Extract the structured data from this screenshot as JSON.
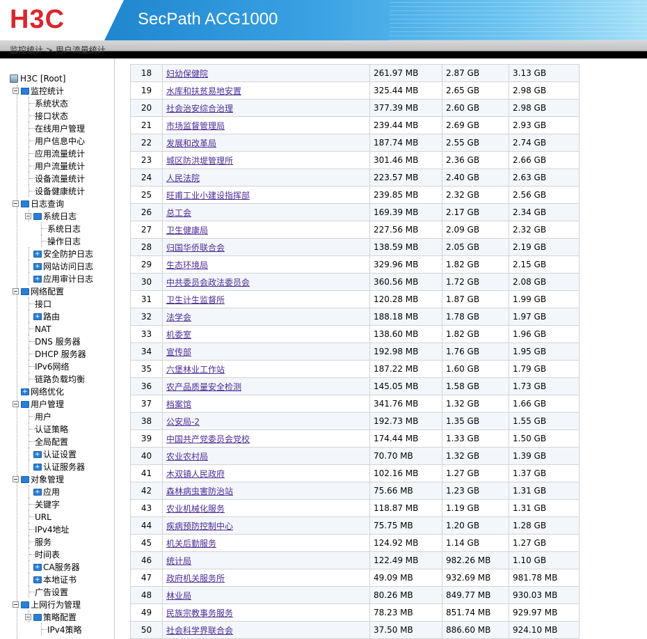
{
  "header": {
    "logo": "H3C",
    "product": "SecPath ACG1000"
  },
  "breadcrumb": {
    "part1": "监控统计",
    "sep": " > ",
    "part2": "用户流量统计"
  },
  "tree": {
    "root": "H3C [Root]",
    "items": [
      "监控统计",
      "系统状态",
      "接口状态",
      "在线用户管理",
      "用户信息中心",
      "应用流量统计",
      "用户流量统计",
      "设备流量统计",
      "设备健康统计",
      "日志查询",
      "系统日志",
      "系统日志",
      "操作日志",
      "安全防护日志",
      "网站访问日志",
      "应用审计日志",
      "网络配置",
      "接口",
      "路由",
      "NAT",
      "DNS 服务器",
      "DHCP 服务器",
      "IPv6网络",
      "链路负载均衡",
      "网络优化",
      "用户管理",
      "用户",
      "认证策略",
      "全局配置",
      "认证设置",
      "认证服务器",
      "对象管理",
      "应用",
      "关键字",
      "URL",
      "IPv4地址",
      "服务",
      "时间表",
      "CA服务器",
      "本地证书",
      "广告设置",
      "上网行为管理",
      "策略配置",
      "IPv4策略"
    ]
  },
  "table": {
    "rows": [
      {
        "idx": "18",
        "name": "妇幼保健院",
        "up": "261.97 MB",
        "down": "2.87 GB",
        "total": "3.13 GB"
      },
      {
        "idx": "19",
        "name": "水库和扶贫易地安置",
        "up": "325.44 MB",
        "down": "2.65 GB",
        "total": "2.98 GB"
      },
      {
        "idx": "20",
        "name": "社会治安综合治理",
        "up": "377.39 MB",
        "down": "2.60 GB",
        "total": "2.98 GB"
      },
      {
        "idx": "21",
        "name": "市场监督管理局",
        "up": "239.44 MB",
        "down": "2.69 GB",
        "total": "2.93 GB"
      },
      {
        "idx": "22",
        "name": "发展和改革局",
        "up": "187.74 MB",
        "down": "2.55 GB",
        "total": "2.74 GB"
      },
      {
        "idx": "23",
        "name": "城区防洪堤管理所",
        "up": "301.46 MB",
        "down": "2.36 GB",
        "total": "2.66 GB"
      },
      {
        "idx": "24",
        "name": "人民法院",
        "up": "223.57 MB",
        "down": "2.40 GB",
        "total": "2.63 GB"
      },
      {
        "idx": "25",
        "name": "旺甫工业小建设指挥部",
        "up": "239.85 MB",
        "down": "2.32 GB",
        "total": "2.56 GB"
      },
      {
        "idx": "26",
        "name": "总工会",
        "up": "169.39 MB",
        "down": "2.17 GB",
        "total": "2.34 GB"
      },
      {
        "idx": "27",
        "name": "卫生健康局",
        "up": "227.56 MB",
        "down": "2.09 GB",
        "total": "2.32 GB"
      },
      {
        "idx": "28",
        "name": "归国华侨联合会",
        "up": "138.59 MB",
        "down": "2.05 GB",
        "total": "2.19 GB"
      },
      {
        "idx": "29",
        "name": "生态环境局",
        "up": "329.96 MB",
        "down": "1.82 GB",
        "total": "2.15 GB"
      },
      {
        "idx": "30",
        "name": "中共委员会政法委员会",
        "up": "360.56 MB",
        "down": "1.72 GB",
        "total": "2.08 GB"
      },
      {
        "idx": "31",
        "name": "卫生计生监督所",
        "up": "120.28 MB",
        "down": "1.87 GB",
        "total": "1.99 GB"
      },
      {
        "idx": "32",
        "name": "法学会",
        "up": "188.18 MB",
        "down": "1.78 GB",
        "total": "1.97 GB"
      },
      {
        "idx": "33",
        "name": "机委室",
        "up": "138.60 MB",
        "down": "1.82 GB",
        "total": "1.96 GB"
      },
      {
        "idx": "34",
        "name": "宣传部",
        "up": "192.98 MB",
        "down": "1.76 GB",
        "total": "1.95 GB"
      },
      {
        "idx": "35",
        "name": "六堡林业工作站",
        "up": "187.22 MB",
        "down": "1.60 GB",
        "total": "1.79 GB"
      },
      {
        "idx": "36",
        "name": "农产品质量安全检测",
        "up": "145.05 MB",
        "down": "1.58 GB",
        "total": "1.73 GB"
      },
      {
        "idx": "37",
        "name": "档案馆",
        "up": "341.76 MB",
        "down": "1.32 GB",
        "total": "1.66 GB"
      },
      {
        "idx": "38",
        "name": "公安局-2",
        "up": "192.73 MB",
        "down": "1.35 GB",
        "total": "1.55 GB"
      },
      {
        "idx": "39",
        "name": "中国共产党委员会党校",
        "up": "174.44 MB",
        "down": "1.33 GB",
        "total": "1.50 GB"
      },
      {
        "idx": "40",
        "name": "农业农村局",
        "up": "70.70 MB",
        "down": "1.32 GB",
        "total": "1.39 GB"
      },
      {
        "idx": "41",
        "name": "木双镇人民政府",
        "up": "102.16 MB",
        "down": "1.27 GB",
        "total": "1.37 GB"
      },
      {
        "idx": "42",
        "name": "森林病虫害防治站",
        "up": "75.66 MB",
        "down": "1.23 GB",
        "total": "1.31 GB"
      },
      {
        "idx": "43",
        "name": "农业机械化服务",
        "up": "118.87 MB",
        "down": "1.19 GB",
        "total": "1.31 GB"
      },
      {
        "idx": "44",
        "name": "疾病预防控制中心",
        "up": "75.75 MB",
        "down": "1.20 GB",
        "total": "1.28 GB"
      },
      {
        "idx": "45",
        "name": "机关后勤服务",
        "up": "124.92 MB",
        "down": "1.14 GB",
        "total": "1.27 GB"
      },
      {
        "idx": "46",
        "name": "统计局",
        "up": "122.49 MB",
        "down": "982.26 MB",
        "total": "1.10 GB"
      },
      {
        "idx": "47",
        "name": "政府机关服务所",
        "up": "49.09 MB",
        "down": "932.69 MB",
        "total": "981.78 MB"
      },
      {
        "idx": "48",
        "name": "林业局",
        "up": "80.26 MB",
        "down": "849.77 MB",
        "total": "930.03 MB"
      },
      {
        "idx": "49",
        "name": "民族宗教事务服务",
        "up": "78.23 MB",
        "down": "851.74 MB",
        "total": "929.97 MB"
      },
      {
        "idx": "50",
        "name": "社会科学界联合会",
        "up": "37.50 MB",
        "down": "886.60 MB",
        "total": "924.10 MB"
      }
    ]
  }
}
